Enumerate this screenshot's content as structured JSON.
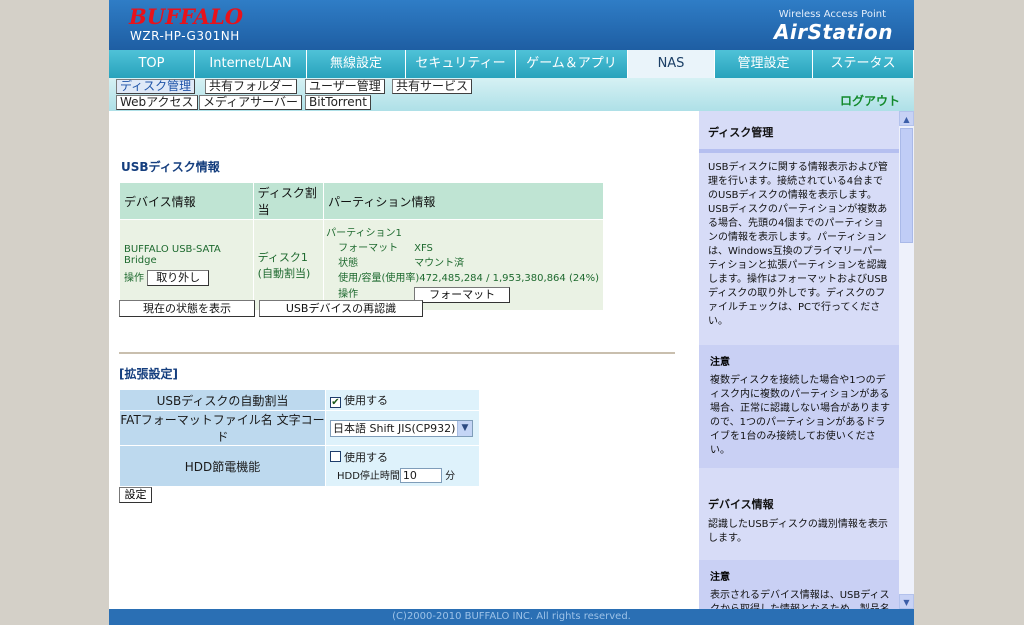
{
  "header": {
    "brand": "BUFFALO",
    "model": "WZR-HP-G301NH",
    "product_line": "Wireless Access Point",
    "product_name": "AirStation"
  },
  "nav": {
    "tabs": [
      "TOP",
      "Internet/LAN",
      "無線設定",
      "セキュリティー",
      "ゲーム＆アプリ",
      "NAS",
      "管理設定",
      "ステータス"
    ],
    "active": "NAS"
  },
  "subnav": {
    "row1": [
      "ディスク管理",
      "共有フォルダー",
      "ユーザー管理",
      "共有サービス"
    ],
    "row2": [
      "Webアクセス",
      "メディアサーバー",
      "BitTorrent"
    ],
    "active": "ディスク管理",
    "logout": "ログアウト"
  },
  "usb": {
    "title": "USBディスク情報",
    "headers": [
      "デバイス情報",
      "ディスク割当",
      "パーティション情報"
    ],
    "device_name": "BUFFALO USB-SATA Bridge",
    "operation_label": "操作",
    "remove_button": "取り外し",
    "disk_assign_line1": "ディスク1",
    "disk_assign_line2": "(自動割当)",
    "partition_title": "パーティション1",
    "format_label": "フォーマット",
    "format_value": "XFS",
    "status_label": "状態",
    "status_value": "マウント済",
    "usage_label": "使用/容量(使用率)",
    "usage_value": "472,485,284 / 1,953,380,864 (24%)",
    "operation_label2": "操作",
    "format_button": "フォーマット",
    "show_status_button": "現在の状態を表示",
    "rescan_button": "USBデバイスの再認識"
  },
  "ext": {
    "title": "[拡張設定]",
    "auto_assign_label": "USBディスクの自動割当",
    "auto_assign_value": "使用する",
    "fat_label": "FATフォーマットファイル名 文字コード",
    "fat_value": "日本語 Shift JIS(CP932)",
    "hdd_label": "HDD節電機能",
    "hdd_use": "使用する",
    "hdd_stop_label": "HDD停止時間",
    "hdd_stop_value": "10",
    "hdd_stop_unit": "分",
    "apply_button": "設定"
  },
  "help": {
    "title": "ディスク管理",
    "body": "USBディスクに関する情報表示および管理を行います。接続されている4台までのUSBディスクの情報を表示します。USBディスクのパーティションが複数ある場合、先頭の4個までのパーティションの情報を表示します。パーティションは、Windows互換のプライマリーパーティションと拡張パーティションを認識します。操作はフォーマットおよびUSBディスクの取り外しです。ディスクのファイルチェックは、PCで行ってください。",
    "note_title": "注意",
    "note_body": "複数ディスクを接続した場合や1つのディスク内に複数のパーティションがある場合、正常に認識しない場合がありますので、1つのパーティションがあるドライブを1台のみ接続してお使いください。",
    "device_title": "デバイス情報",
    "device_body": "認識したUSBディスクの識別情報を表示します。",
    "note2_title": "注意",
    "note2_body": "表示されるデバイス情報は、USBディスクから取得した情報となるため、製品名とは表記が異なる場合がありま"
  },
  "footer": "(C)2000-2010 BUFFALO INC. All rights reserved."
}
